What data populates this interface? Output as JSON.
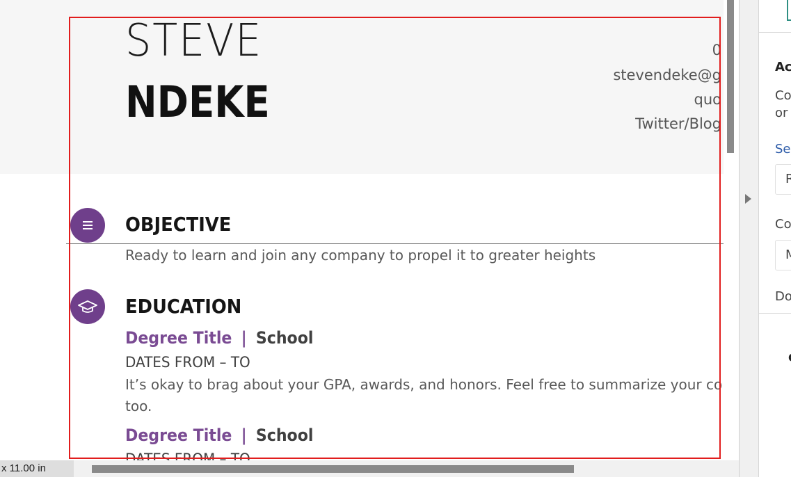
{
  "resume": {
    "first_name": "STEVE",
    "last_name": "NDEKE",
    "contact": {
      "phone": "0",
      "email": "stevendeke@g",
      "address": "quo",
      "social": "Twitter/Blog"
    },
    "objective": {
      "title": "OBJECTIVE",
      "text": "Ready to learn and join any company to propel it to greater heights"
    },
    "education": {
      "title": "EDUCATION",
      "entries": [
        {
          "degree": "Degree Title",
          "separator": "|",
          "school": "School",
          "dates": "DATES FROM – TO",
          "description_line1": "It’s okay to brag about your GPA, awards, and honors. Feel free to summarize your co",
          "description_line2": "too."
        },
        {
          "degree": "Degree Title",
          "separator": "|",
          "school": "School",
          "dates": "DATES FROM – TO"
        }
      ]
    }
  },
  "status_bar": {
    "page_size": "x 11.00 in"
  },
  "side_panel": {
    "heading": "Ac",
    "desc_line1": "Co",
    "desc_line2": "or",
    "select_link": "Sel",
    "field1_label": "",
    "field1_value": "R",
    "field2_label": "Co",
    "field2_value": "M",
    "footer_text": "Do",
    "bottom_glyph": "C"
  },
  "colors": {
    "accent_purple": "#6f3f8b",
    "selection_red": "#e11d1d",
    "header_band": "#f6f6f6"
  },
  "icons": {
    "objective": "list-icon",
    "education": "graduation-cap-icon"
  }
}
